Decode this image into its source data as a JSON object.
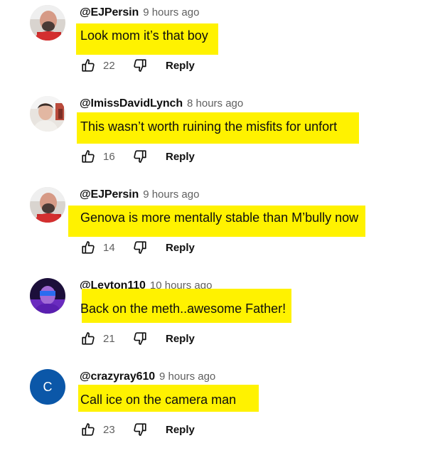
{
  "comments": [
    {
      "author": "@EJPersin",
      "time": "9 hours ago",
      "text": "Look mom it’s that boy",
      "likes": "22",
      "reply_label": "Reply",
      "avatar": "photo-man-bald"
    },
    {
      "author": "@ImissDavidLynch",
      "time": "8 hours ago",
      "text": "This wasn’t worth ruining the misfits for unfort",
      "likes": "16",
      "reply_label": "Reply",
      "avatar": "photo-man-hair"
    },
    {
      "author": "@EJPersin",
      "time": "9 hours ago",
      "text": "Genova is more mentally stable than M’bully now",
      "likes": "14",
      "reply_label": "Reply",
      "avatar": "photo-man-bald"
    },
    {
      "author": "@Leyton110",
      "time": "10 hours ago",
      "text": "Back on the meth..awesome Father!",
      "likes": "21",
      "reply_label": "Reply",
      "avatar": "photo-purple"
    },
    {
      "author": "@crazyray610",
      "time": "9 hours ago",
      "text": "Call ice on the camera man",
      "likes": "23",
      "reply_label": "Reply",
      "avatar_letter": "C",
      "avatar_color": "#0b57a8"
    }
  ],
  "highlight_color": "#fff200"
}
